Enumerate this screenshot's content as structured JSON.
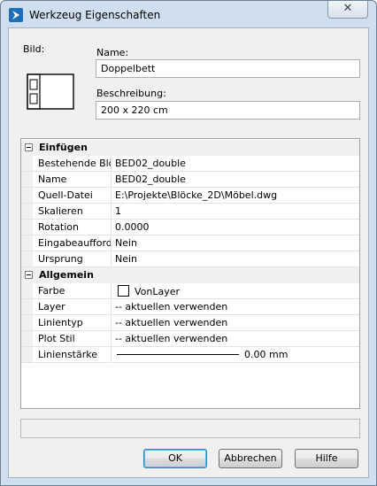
{
  "window": {
    "title": "Werkzeug Eigenschaften",
    "close_symbol": "✕"
  },
  "form": {
    "bild_label": "Bild:",
    "name_label": "Name:",
    "name_value": "Doppelbett",
    "beschreibung_label": "Beschreibung:",
    "beschreibung_value": "200 x 220 cm"
  },
  "groups": {
    "einfuegen": {
      "title": "Einfügen",
      "rows": [
        {
          "name": "Bestehende Blöcke",
          "value": "BED02_double"
        },
        {
          "name": "Name",
          "value": "BED02_double"
        },
        {
          "name": "Quell-Datei",
          "value": "E:\\Projekte\\Blöcke_2D\\Möbel.dwg"
        },
        {
          "name": "Skalieren",
          "value": "1"
        },
        {
          "name": "Rotation",
          "value": "0.0000"
        },
        {
          "name": "Eingabeaufforderung",
          "value": "Nein"
        },
        {
          "name": "Ursprung",
          "value": "Nein"
        }
      ]
    },
    "allgemein": {
      "title": "Allgemein",
      "rows": [
        {
          "name": "Farbe",
          "value": "VonLayer"
        },
        {
          "name": "Layer",
          "value": "-- aktuellen verwenden"
        },
        {
          "name": "Linientyp",
          "value": "-- aktuellen verwenden"
        },
        {
          "name": "Plot Stil",
          "value": "-- aktuellen verwenden"
        },
        {
          "name": "Linienstärke",
          "value": "0.00 mm"
        }
      ]
    }
  },
  "status_text": "",
  "buttons": {
    "ok": "OK",
    "cancel": "Abbrechen",
    "help": "Hilfe"
  },
  "colors": {
    "title_bg": "#cfdff0",
    "client_bg": "#f0f0f0",
    "default_button_border": "#3c7fb1"
  }
}
